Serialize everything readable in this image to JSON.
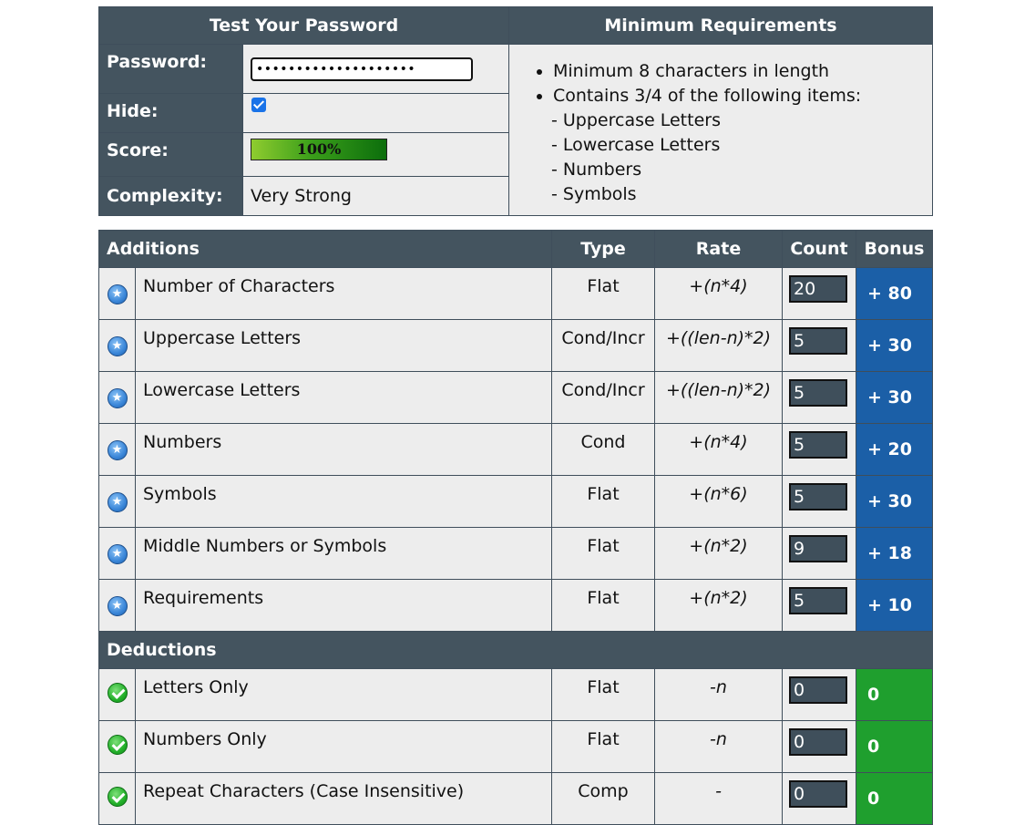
{
  "summary": {
    "title_left": "Test Your Password",
    "title_right": "Minimum Requirements",
    "password_label": "Password:",
    "password_value": "••••••••••••••••••••",
    "hide_label": "Hide:",
    "hide_checked": true,
    "score_label": "Score:",
    "score_text": "100%",
    "score_fraction": 1.0,
    "complexity_label": "Complexity:",
    "complexity_value": "Very Strong"
  },
  "requirements": {
    "items": [
      "Minimum 8 characters in length",
      "Contains 3/4 of the following items:"
    ],
    "sub_items": [
      "- Uppercase Letters",
      "- Lowercase Letters",
      "- Numbers",
      "- Symbols"
    ]
  },
  "table": {
    "columns": {
      "additions": "Additions",
      "type": "Type",
      "rate": "Rate",
      "count": "Count",
      "bonus": "Bonus"
    },
    "additions": [
      {
        "name": "Number of Characters",
        "type": "Flat",
        "rate": "+(n*4)",
        "count": "20",
        "bonus": "+ 80"
      },
      {
        "name": "Uppercase Letters",
        "type": "Cond/Incr",
        "rate": "+((len-n)*2)",
        "count": "5",
        "bonus": "+ 30"
      },
      {
        "name": "Lowercase Letters",
        "type": "Cond/Incr",
        "rate": "+((len-n)*2)",
        "count": "5",
        "bonus": "+ 30"
      },
      {
        "name": "Numbers",
        "type": "Cond",
        "rate": "+(n*4)",
        "count": "5",
        "bonus": "+ 20"
      },
      {
        "name": "Symbols",
        "type": "Flat",
        "rate": "+(n*6)",
        "count": "5",
        "bonus": "+ 30"
      },
      {
        "name": "Middle Numbers or Symbols",
        "type": "Flat",
        "rate": "+(n*2)",
        "count": "9",
        "bonus": "+ 18"
      },
      {
        "name": "Requirements",
        "type": "Flat",
        "rate": "+(n*2)",
        "count": "5",
        "bonus": "+ 10"
      }
    ],
    "deductions_label": "Deductions",
    "deductions": [
      {
        "name": "Letters Only",
        "type": "Flat",
        "rate": "-n",
        "count": "0",
        "bonus": "0"
      },
      {
        "name": "Numbers Only",
        "type": "Flat",
        "rate": "-n",
        "count": "0",
        "bonus": "0"
      },
      {
        "name": "Repeat Characters (Case Insensitive)",
        "type": "Comp",
        "rate": "-",
        "count": "0",
        "bonus": "0"
      }
    ]
  },
  "colors": {
    "header_bg": "#44545f",
    "bonus_blue": "#1b5fa7",
    "bonus_green": "#1f9f2e",
    "score_bar_dark": "#0c6e0c",
    "score_bar_light": "#8fcc2f"
  },
  "icons": {
    "addition": "star-icon",
    "deduction": "check-icon"
  }
}
